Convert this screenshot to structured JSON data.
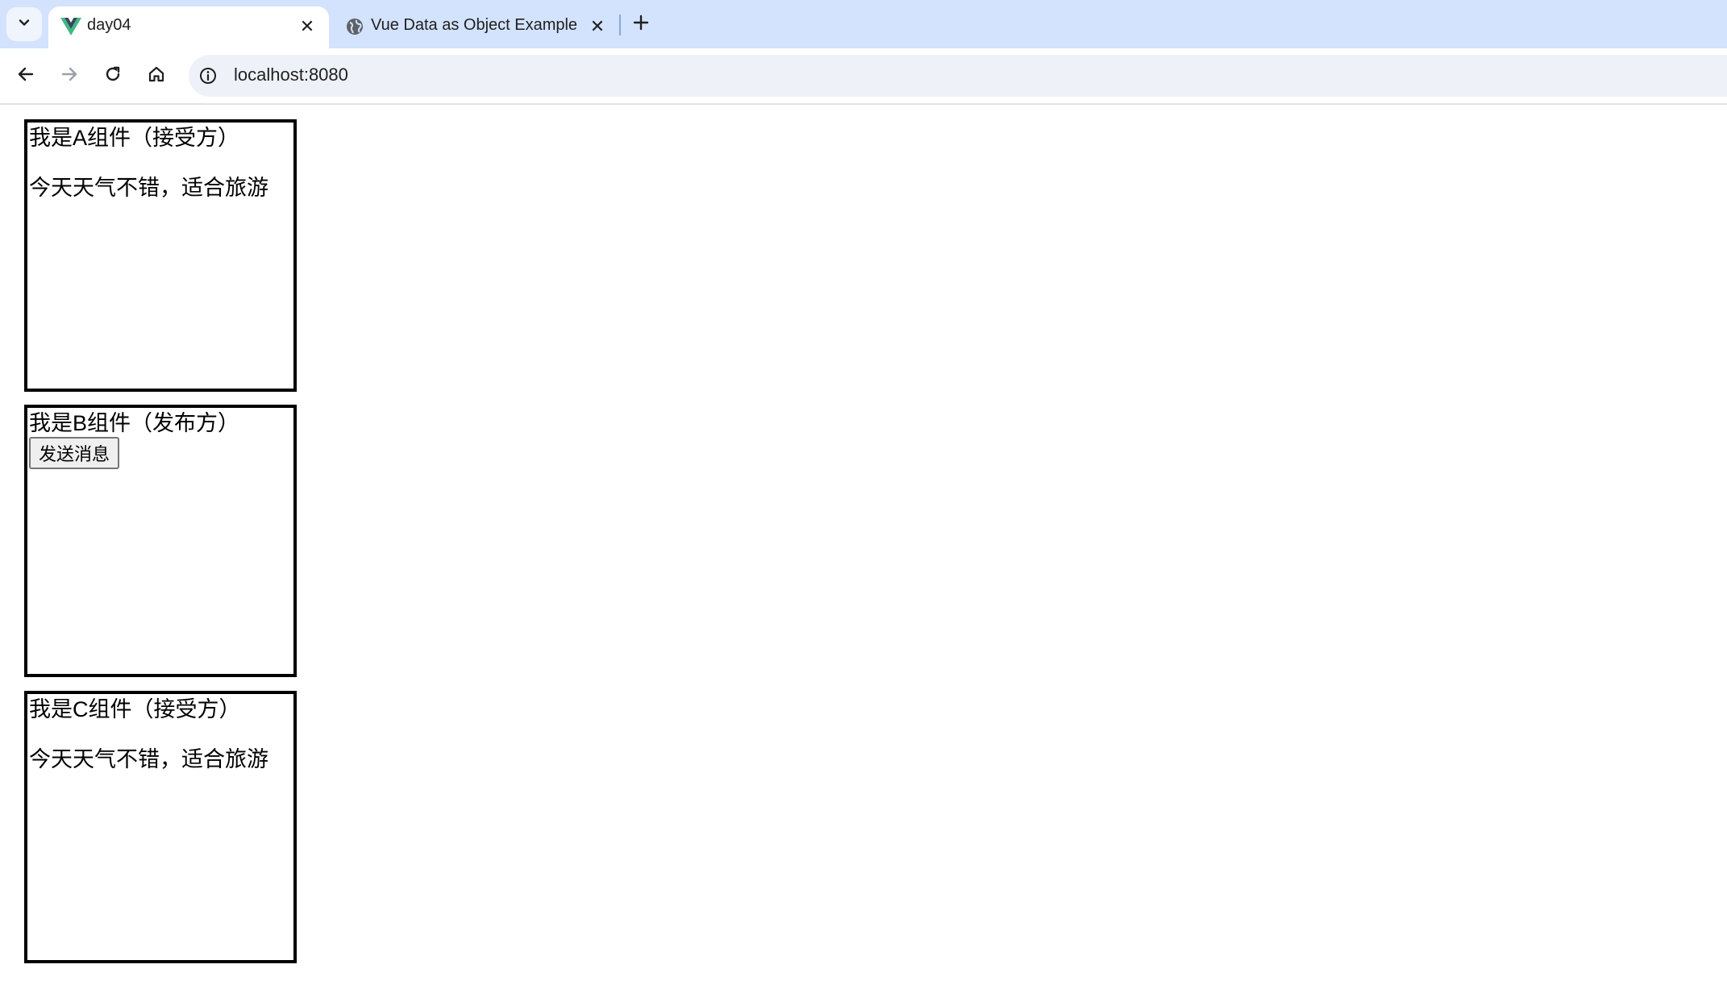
{
  "browser": {
    "tabs": [
      {
        "title": "day04",
        "active": true,
        "favicon": "vue-logo-icon"
      },
      {
        "title": "Vue Data as Object Example",
        "active": false,
        "favicon": "globe-icon"
      }
    ],
    "address_bar": {
      "url": "localhost:8080"
    }
  },
  "components": {
    "a": {
      "heading": "我是A组件（接受方）",
      "message": "今天天气不错，适合旅游"
    },
    "b": {
      "heading": "我是B组件（发布方）",
      "button_label": "发送消息"
    },
    "c": {
      "heading": "我是C组件（接受方）",
      "message": "今天天气不错，适合旅游"
    }
  },
  "colors": {
    "tabstrip_bg": "#d3e3fd",
    "vue_green": "#41b883",
    "vue_dark": "#35495e"
  }
}
